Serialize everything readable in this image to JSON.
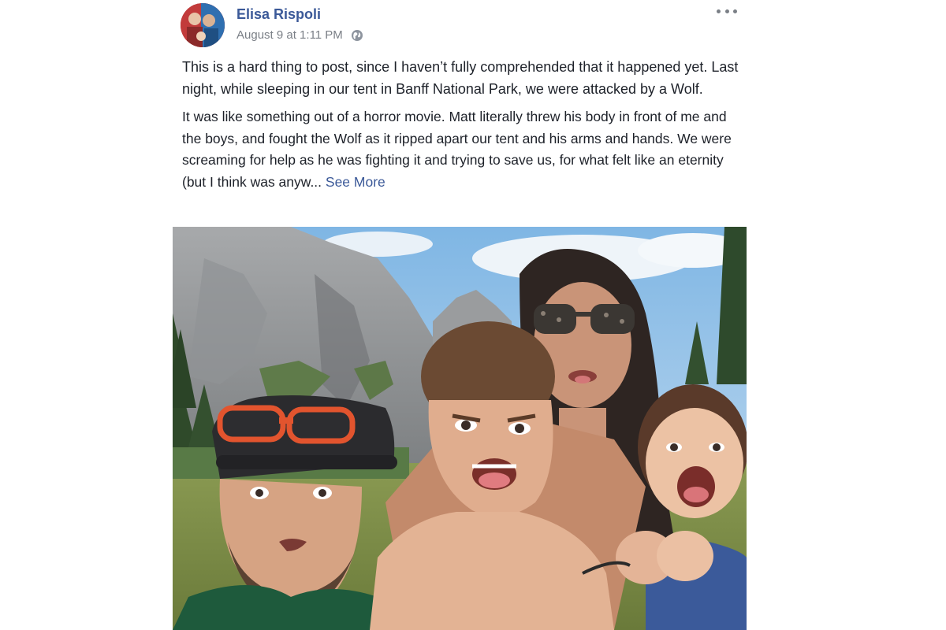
{
  "post": {
    "author": "Elisa Rispoli",
    "timestamp": "August 9 at 1:11 PM",
    "privacy_icon": "globe-icon",
    "more_icon": "more-options-icon",
    "paragraphs": [
      "This is a hard thing to post, since I haven’t fully comprehended that it happened yet. Last night, while sleeping in our tent in Banff National Park, we were attacked by a Wolf.",
      "It was like something out of a horror movie. Matt literally threw his body in front of me and the boys, and fought the Wolf as it ripped apart our tent and his arms and hands. We were screaming for help as he was fighting it and trying to save us, for what felt like an eternity (but I think was anyw..."
    ],
    "see_more_label": "See More"
  },
  "colors": {
    "link": "#3b5998",
    "meta_text": "#7a7f86",
    "body_text": "#1d2129",
    "background": "#ffffff"
  }
}
